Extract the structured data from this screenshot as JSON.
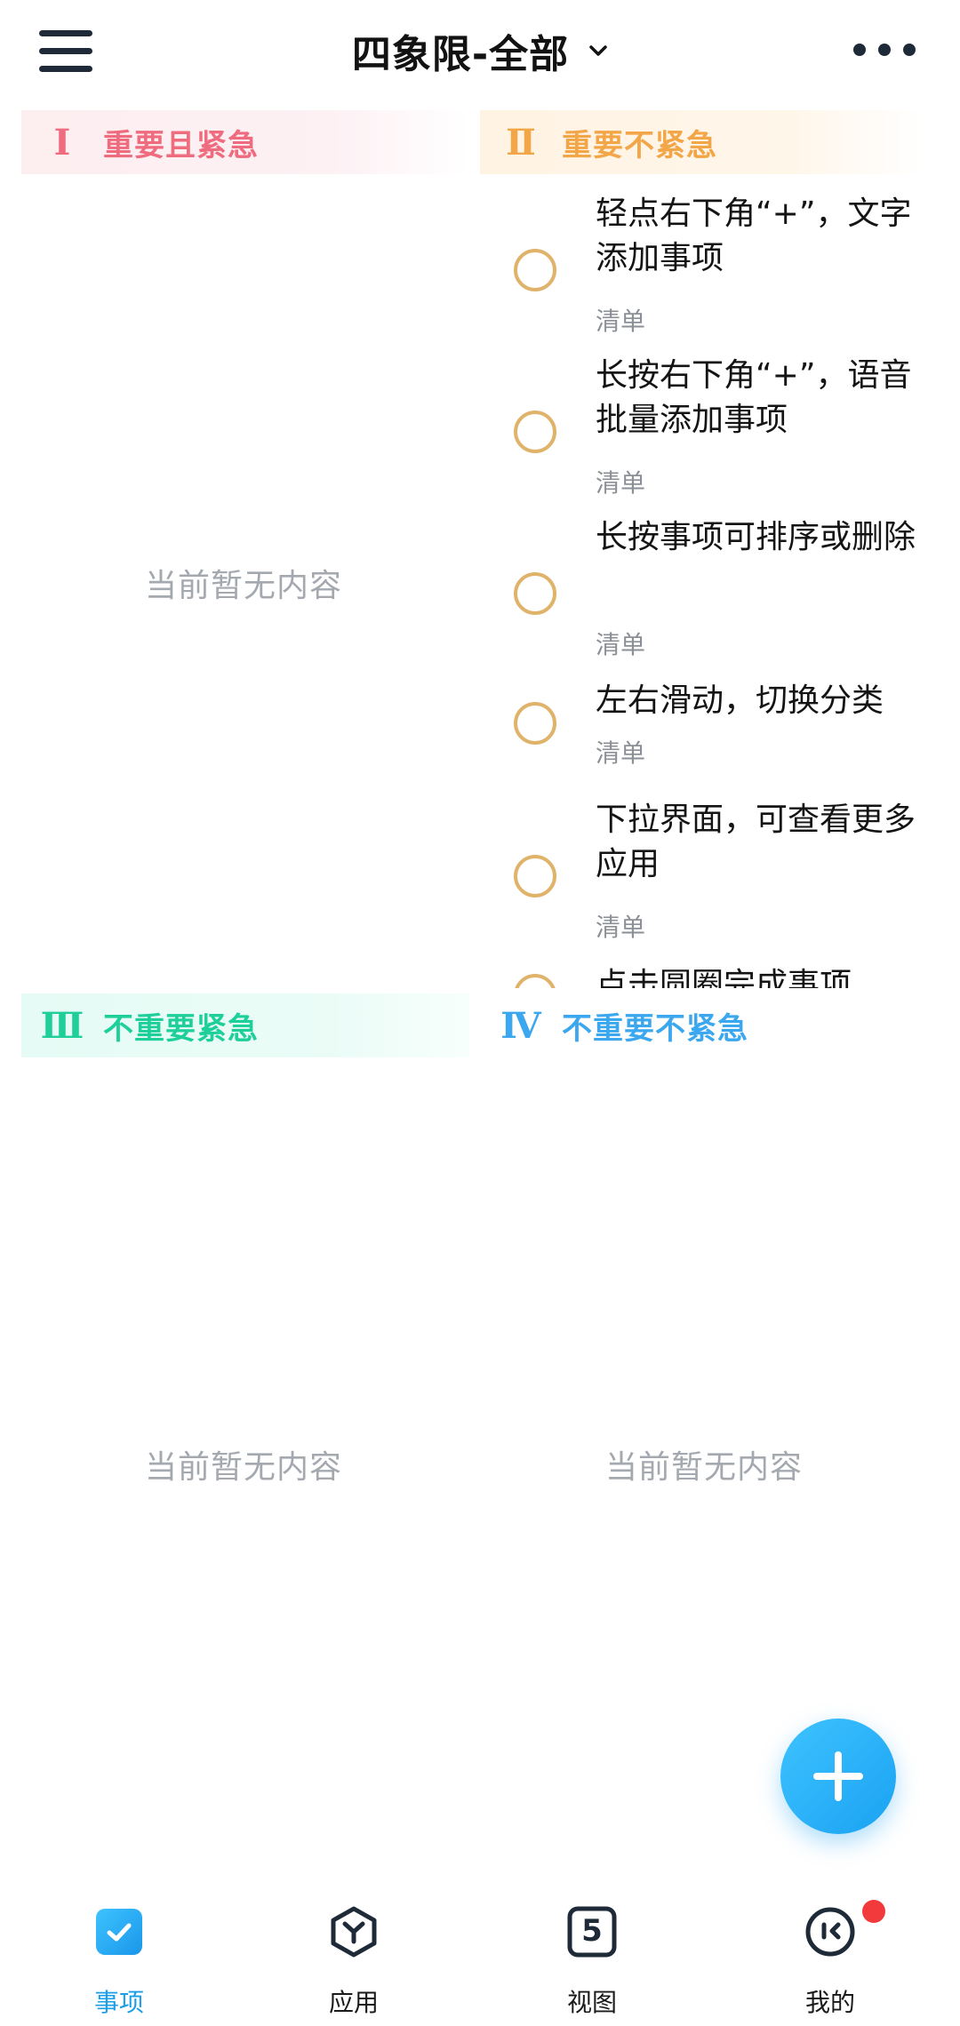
{
  "header": {
    "title": "四象限-全部",
    "menu_icon": "hamburger-menu-icon",
    "more_icon": "more-dots-icon"
  },
  "quadrants": {
    "q1": {
      "numeral": "Ⅰ",
      "label": "重要且紧急",
      "empty_text": "当前暂无内容",
      "color": "#ef6b7e"
    },
    "q2": {
      "numeral": "Ⅱ",
      "label": "重要不紧急",
      "color": "#f2a648",
      "tasks": [
        {
          "title": "轻点右下角“+”，文字添加事项",
          "list": "清单"
        },
        {
          "title": "长按右下角“+”，语音批量添加事项",
          "list": "清单"
        },
        {
          "title": "长按事项可排序或删除",
          "list": "清单"
        },
        {
          "title": "左右滑动，切换分类",
          "list": "清单"
        },
        {
          "title": "下拉界面，可查看更多应用",
          "list": "清单"
        },
        {
          "title": "点击圆圈完成事项",
          "list": ""
        }
      ]
    },
    "q3": {
      "numeral": "Ⅲ",
      "label": "不重要紧急",
      "empty_text": "当前暂无内容",
      "color": "#1ecf9a"
    },
    "q4": {
      "numeral": "Ⅳ",
      "label": "不重要不紧急",
      "empty_text": "当前暂无内容",
      "color": "#3ba7ee"
    }
  },
  "fab": {
    "icon": "plus-icon",
    "color": "#1aa2f2"
  },
  "bottom_nav": {
    "items": [
      {
        "label": "事项",
        "icon": "checkbox-icon",
        "active": true
      },
      {
        "label": "应用",
        "icon": "apps-hexagon-icon",
        "active": false
      },
      {
        "label": "视图",
        "icon": "calendar-view-icon",
        "active": false,
        "icon_number": "5"
      },
      {
        "label": "我的",
        "icon": "profile-face-icon",
        "active": false,
        "has_badge": true
      }
    ]
  }
}
